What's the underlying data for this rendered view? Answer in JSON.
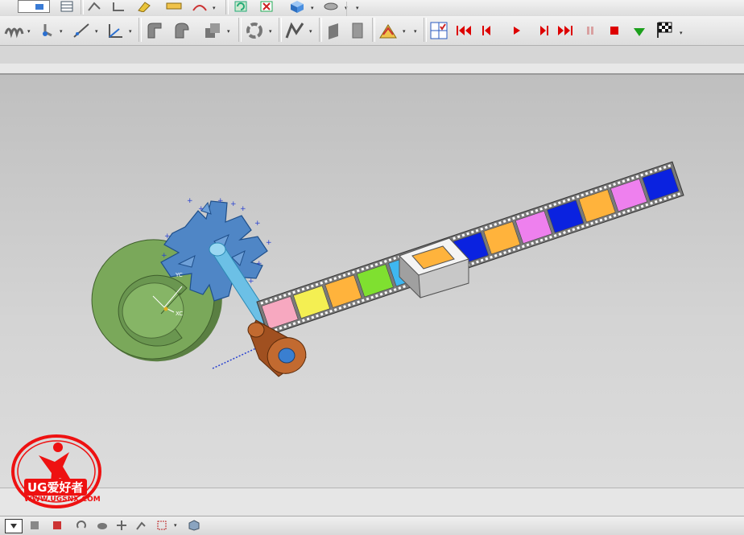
{
  "window": {
    "title": ""
  },
  "toolbar_row1": {
    "icons": [
      "layer-select-icon",
      "table-icon",
      "sketch-icon",
      "datum-icon",
      "measure-icon",
      "ruler-icon",
      "analysis-icon",
      "refresh-icon",
      "close-part-icon",
      "cube-icon",
      "layout-icon"
    ]
  },
  "toolbar_row2": {
    "icons": [
      "spring-icon",
      "joint-icon",
      "line-icon",
      "axis-icon",
      "bend-icon",
      "offset-icon",
      "boolean-icon",
      "connector-icon",
      "path-icon",
      "block-icon",
      "sheet-icon",
      "fold-icon"
    ],
    "animation": [
      "checklist-icon",
      "rewind-start-icon",
      "step-back-icon",
      "play-icon",
      "step-forward-icon",
      "fast-forward-icon",
      "pause-icon",
      "stop-icon",
      "down-arrow-icon",
      "finish-flag-icon"
    ]
  },
  "colors": {
    "gear": "#4f86c6",
    "disc": "#7aa85a",
    "shaft": "#6cc0e6",
    "roller": "#b8622c",
    "film": "#7a7a7a",
    "frames": [
      "#f7a8c0",
      "#f4ef52",
      "#ffb33c",
      "#7fe030",
      "#3fb7f0",
      "#f090f0",
      "#0a22e0",
      "#ffb33c",
      "#ee80ee",
      "#0a22e0",
      "#ffb33c",
      "#ee80ee",
      "#0a22e0"
    ]
  },
  "viewport": {
    "axis_labels": {
      "yc": "YC",
      "xc": "XC",
      "zc": "ZC"
    }
  },
  "watermark": {
    "brand": "UG爱好者",
    "url": "WWW.UGSNX.COM"
  }
}
